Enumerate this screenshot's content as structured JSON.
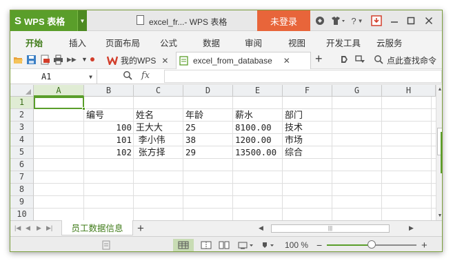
{
  "app": {
    "name": "WPS 表格",
    "window_title": "excel_fr...- WPS 表格",
    "login_label": "未登录",
    "accent_color": "#5a9e2a",
    "login_color": "#e8653a"
  },
  "menu": {
    "tabs": [
      "开始",
      "插入",
      "页面布局",
      "公式",
      "数据",
      "审阅",
      "视图",
      "开发工具",
      "云服务"
    ],
    "active": "开始"
  },
  "doc_tabs": [
    {
      "label": "我的WPS",
      "icon": "wps-logo-icon",
      "active": false
    },
    {
      "label": "excel_from_database",
      "icon": "spreadsheet-doc-icon",
      "active": true
    }
  ],
  "toolbar": {
    "search_label": "点此查找命令"
  },
  "formula_bar": {
    "cell_ref": "A1",
    "fx_label": "fx",
    "value": ""
  },
  "sheet": {
    "columns": [
      "A",
      "B",
      "C",
      "D",
      "E",
      "F",
      "G",
      "H"
    ],
    "row_numbers": [
      "1",
      "2",
      "3",
      "4",
      "5",
      "6",
      "7",
      "8",
      "9",
      "10"
    ],
    "selected_cell": "A1",
    "cells": {
      "B2": "编号",
      "C2": "姓名",
      "D2": "年龄",
      "E2": "薪水",
      "F2": "部门",
      "B3": "100",
      "C3": "王大大",
      "D3": "25",
      "E3": "8100.00",
      "F3": "技术",
      "B4": "101",
      "C4": " 李小伟",
      "D4": "38",
      "E4": "1200.00",
      "F4": "市场",
      "B5": "102",
      "C5": " 张方择",
      "D5": "29",
      "E5": "13500.00",
      "F5": "综合"
    }
  },
  "sheet_tabs": [
    {
      "label": "员工数据信息",
      "active": true
    }
  ],
  "status": {
    "zoom_label": "100 %",
    "zoom_value": 0.5
  }
}
